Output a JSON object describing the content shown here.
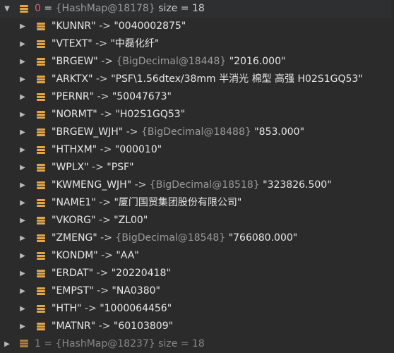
{
  "root": {
    "index": "0",
    "equals": "=",
    "ref": "{HashMap@18178}",
    "size": "size = 18"
  },
  "entries": [
    {
      "key": "\"KUNNR\"",
      "arrow": "->",
      "ref": "",
      "value": "\"0040002875\""
    },
    {
      "key": "\"VTEXT\"",
      "arrow": "->",
      "ref": "",
      "value": "\"中磊化纤\""
    },
    {
      "key": "\"BRGEW\"",
      "arrow": "->",
      "ref": "{BigDecimal@18448}",
      "value": "\"2016.000\""
    },
    {
      "key": "\"ARKTX\"",
      "arrow": "->",
      "ref": "",
      "value": "\"PSF\\1.56dtex/38mm 半消光 棉型 高强 H02S1GQ53\""
    },
    {
      "key": "\"PERNR\"",
      "arrow": "->",
      "ref": "",
      "value": "\"50047673\""
    },
    {
      "key": "\"NORMT\"",
      "arrow": "->",
      "ref": "",
      "value": "\"H02S1GQ53\""
    },
    {
      "key": "\"BRGEW_WJH\"",
      "arrow": "->",
      "ref": "{BigDecimal@18488}",
      "value": "\"853.000\""
    },
    {
      "key": "\"HTHXM\"",
      "arrow": "->",
      "ref": "",
      "value": "\"000010\""
    },
    {
      "key": "\"WPLX\"",
      "arrow": "->",
      "ref": "",
      "value": "\"PSF\""
    },
    {
      "key": "\"KWMENG_WJH\"",
      "arrow": "->",
      "ref": "{BigDecimal@18518}",
      "value": "\"323826.500\""
    },
    {
      "key": "\"NAME1\"",
      "arrow": "->",
      "ref": "",
      "value": "\"厦门国贸集团股份有限公司\""
    },
    {
      "key": "\"VKORG\"",
      "arrow": "->",
      "ref": "",
      "value": "\"ZL00\""
    },
    {
      "key": "\"ZMENG\"",
      "arrow": "->",
      "ref": "{BigDecimal@18548}",
      "value": "\"766080.000\""
    },
    {
      "key": "\"KONDM\"",
      "arrow": "->",
      "ref": "",
      "value": "\"AA\""
    },
    {
      "key": "\"ERDAT\"",
      "arrow": "->",
      "ref": "",
      "value": "\"20220418\""
    },
    {
      "key": "\"EMPST\"",
      "arrow": "->",
      "ref": "",
      "value": "\"NA0380\""
    },
    {
      "key": "\"HTH\"",
      "arrow": "->",
      "ref": "",
      "value": "\"1000064456\""
    },
    {
      "key": "\"MATNR\"",
      "arrow": "->",
      "ref": "",
      "value": "\"60103809\""
    }
  ],
  "next_root_partial": {
    "text": "1 = {HashMap@18237} size = 18"
  },
  "colors": {
    "background": "#2b2b2b",
    "index": "#e05b6e",
    "field_icon": "#e3a54a",
    "reference": "#9a9a9a",
    "string": "#e8e8e8"
  },
  "icons": {
    "collapse": "triangle-down-icon",
    "expand": "triangle-right-icon",
    "field": "field-list-icon"
  }
}
